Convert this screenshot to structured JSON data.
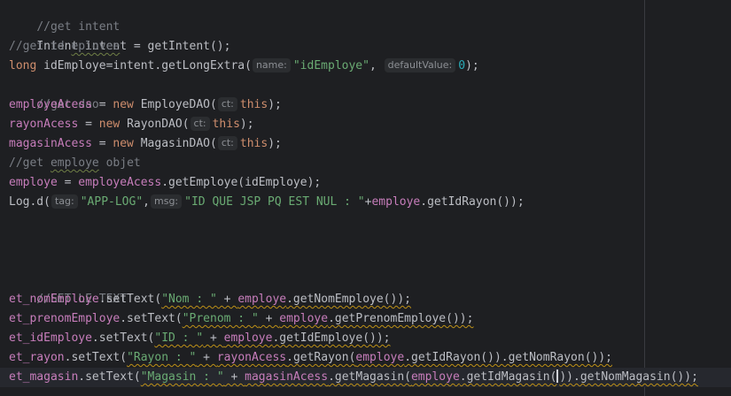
{
  "editor": {
    "lines": [
      {
        "text": "//get intent"
      },
      {
        "text": "Intent intent = getIntent();"
      },
      {
        "comment_prefix": "//get id ",
        "comment_word": "eplovee"
      },
      {
        "type": "long",
        "var": " idEmploye=intent.getLongExtra(",
        "hint1": "name:",
        "str1": "\"idEmploye\"",
        "comma": ", ",
        "hint2": "defaultValue:",
        "num": "0",
        "end": ");"
      },
      {
        "text": "//get dao"
      },
      {
        "field": "employeAcess",
        "eq": " = ",
        "kw": "new",
        "cls": " EmployeDAO(",
        "hint": "ct:",
        "this": "this",
        "end": ");"
      },
      {
        "field": "rayonAcess",
        "eq": " = ",
        "kw": "new",
        "cls": " RayonDAO(",
        "hint": "ct:",
        "this": "this",
        "end": ");"
      },
      {
        "field": "magasinAcess",
        "eq": " = ",
        "kw": "new",
        "cls": " MagasinDAO(",
        "hint": "ct:",
        "this": "this",
        "end": ");"
      },
      {
        "comment_prefix": "//get ",
        "comment_word": "employe",
        "comment_suffix": " objet"
      },
      {
        "field": "employe",
        "eq": " = ",
        "field2": "employeAcess",
        "rest": ".getEmploye(idEmploye);"
      },
      {
        "call": "Log.d(",
        "hint1": "tag:",
        "str1": "\"APP-LOG\"",
        "comma": ",",
        "hint2": "msg:",
        "str2": "\"ID QUE JSP PQ EST NUL : \"",
        "plus": "+",
        "field": "employe",
        "rest": ".getIdRayon());"
      },
      {
        "text": "//SET LE TEXT"
      },
      {
        "field": "et_nomEmploye",
        "call": ".setText(",
        "str": "\"Nom : \"",
        "plus": " + ",
        "field2": "employe",
        "rest": ".getNomEmploye());"
      },
      {
        "field": "et_prenomEmploye",
        "call": ".setText(",
        "str": "\"Prenom : \"",
        "plus": " + ",
        "field2": "employe",
        "rest": ".getPrenomEmploye());"
      },
      {
        "field": "et_idEmploye",
        "call": ".setText(",
        "str": "\"ID : \"",
        "plus": " + ",
        "field2": "employe",
        "rest": ".getIdEmploye());"
      },
      {
        "field": "et_rayon",
        "call": ".setText(",
        "str": "\"Rayon : \"",
        "plus": " + ",
        "field2": "rayonAcess",
        "mid": ".getRayon(",
        "field3": "employe",
        "rest": ".getIdRayon()).getNomRayon());"
      },
      {
        "field": "et_magasin",
        "call": ".setText(",
        "str": "\"Magasin : \"",
        "plus": " + ",
        "field2": "magasinAcess",
        "mid": ".getMagasin(",
        "field3": "employe",
        "rest_a": ".getIdMagasin(",
        "rest_b": ")).getNomMagasin());"
      }
    ]
  }
}
